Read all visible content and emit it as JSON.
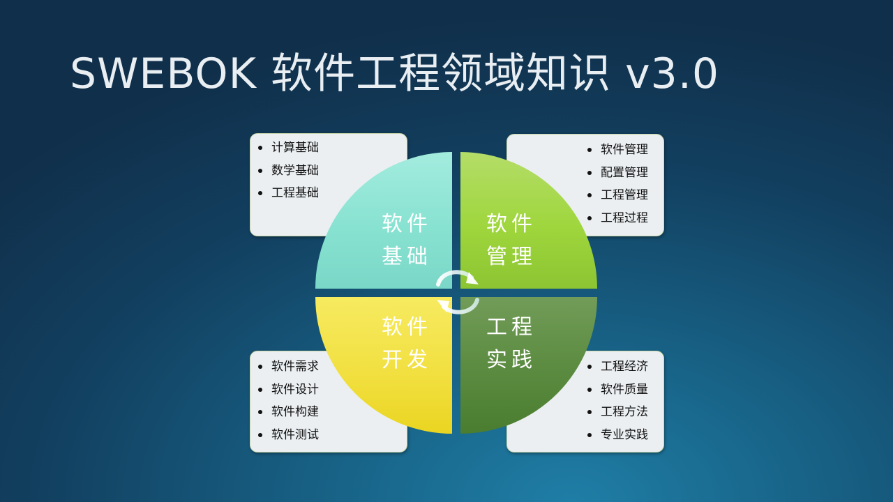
{
  "title": "SWEBOK 软件工程领域知识 v3.0",
  "quadrants": {
    "top_left": {
      "line1": "软件",
      "line2": "基础",
      "color": "#88e2d1"
    },
    "top_right": {
      "line1": "软件",
      "line2": "管理",
      "color": "#9fd63d"
    },
    "bottom_left": {
      "line1": "软件",
      "line2": "开发",
      "color": "#f2e041"
    },
    "bottom_right": {
      "line1": "工程",
      "line2": "实践",
      "color": "#5c8c41"
    }
  },
  "lists": {
    "top_left": [
      "计算基础",
      "数学基础",
      "工程基础"
    ],
    "top_right": [
      "软件管理",
      "配置管理",
      "工程管理",
      "工程过程"
    ],
    "bottom_left": [
      "软件需求",
      "软件设计",
      "软件构建",
      "软件测试"
    ],
    "bottom_right": [
      "工程经济",
      "软件质量",
      "工程方法",
      "专业实践"
    ]
  },
  "icons": {
    "center": "cycle-arrows-icon"
  }
}
